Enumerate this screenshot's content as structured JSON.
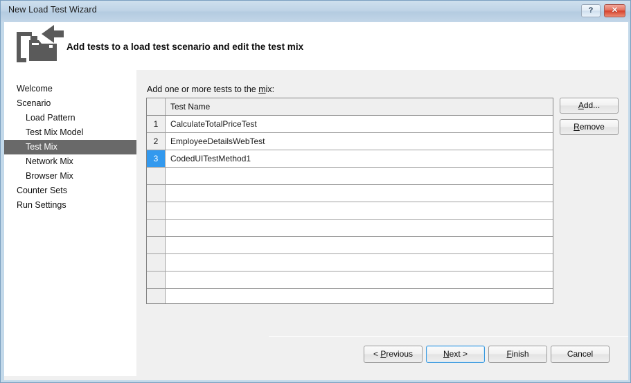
{
  "window": {
    "title": "New Load Test Wizard",
    "help_button": "?",
    "close_button": "✕"
  },
  "banner": {
    "heading": "Add tests to a load test scenario and edit the test mix",
    "icon": "import-to-folder-icon"
  },
  "sidebar": {
    "items": [
      {
        "label": "Welcome",
        "level": 0,
        "selected": false
      },
      {
        "label": "Scenario",
        "level": 0,
        "selected": false
      },
      {
        "label": "Load Pattern",
        "level": 1,
        "selected": false
      },
      {
        "label": "Test Mix Model",
        "level": 1,
        "selected": false
      },
      {
        "label": "Test Mix",
        "level": 1,
        "selected": true
      },
      {
        "label": "Network Mix",
        "level": 1,
        "selected": false
      },
      {
        "label": "Browser Mix",
        "level": 1,
        "selected": false
      },
      {
        "label": "Counter Sets",
        "level": 0,
        "selected": false
      },
      {
        "label": "Run Settings",
        "level": 0,
        "selected": false
      }
    ]
  },
  "main": {
    "grid_label_before": "Add one or more tests to the ",
    "grid_label_accel": "m",
    "grid_label_after": "ix:",
    "columns": [
      "",
      "Test Name"
    ],
    "rows": [
      {
        "num": "1",
        "name": "CalculateTotalPriceTest",
        "selected": false
      },
      {
        "num": "2",
        "name": "EmployeeDetailsWebTest",
        "selected": false
      },
      {
        "num": "3",
        "name": "CodedUITestMethod1",
        "selected": true
      },
      {
        "num": "",
        "name": "",
        "selected": false
      },
      {
        "num": "",
        "name": "",
        "selected": false
      },
      {
        "num": "",
        "name": "",
        "selected": false
      },
      {
        "num": "",
        "name": "",
        "selected": false
      },
      {
        "num": "",
        "name": "",
        "selected": false
      },
      {
        "num": "",
        "name": "",
        "selected": false
      },
      {
        "num": "",
        "name": "",
        "selected": false
      },
      {
        "num": "",
        "name": "",
        "selected": false
      }
    ],
    "buttons": {
      "add_before": "",
      "add_accel": "A",
      "add_after": "dd...",
      "remove_before": "",
      "remove_accel": "R",
      "remove_after": "emove"
    }
  },
  "footer": {
    "previous_before": "< ",
    "previous_accel": "P",
    "previous_after": "revious",
    "next_before": "",
    "next_accel": "N",
    "next_after": "ext >",
    "finish_before": "",
    "finish_accel": "F",
    "finish_after": "inish",
    "cancel": "Cancel"
  },
  "colors": {
    "titlebar": "#bed3e6",
    "frame": "#c3d9ea",
    "selection_nav": "#696969",
    "selection_row": "#3399ee",
    "close_button": "#d6422c",
    "content_bg": "#f0f0f0"
  }
}
